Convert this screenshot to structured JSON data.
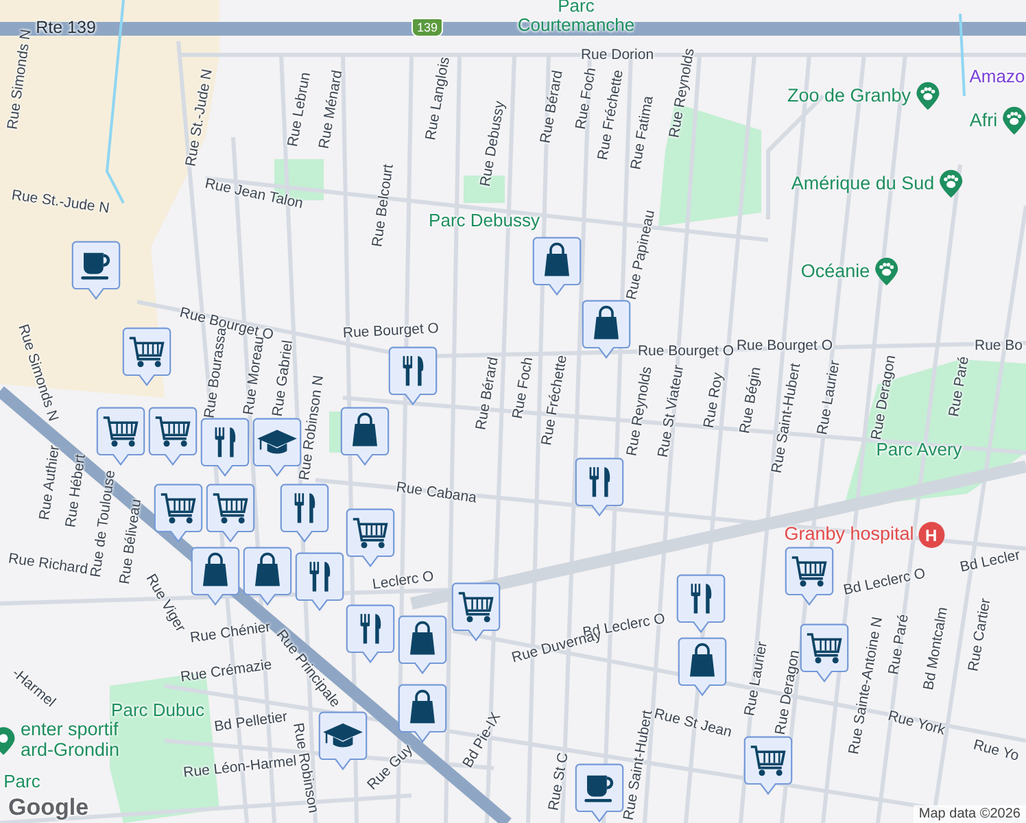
{
  "map": {
    "route_shield": "139",
    "labels": [
      {
        "text": "Rte 139",
        "kind": "highway"
      },
      {
        "text": "Parc Courtemanche",
        "kind": "park"
      },
      {
        "text": "Rue Dorion",
        "kind": "street"
      },
      {
        "text": "Rue Simonds N",
        "kind": "street"
      },
      {
        "text": "Rue St.-Jude N",
        "kind": "street"
      },
      {
        "text": "Rue Lebrun",
        "kind": "street"
      },
      {
        "text": "Rue Ménard",
        "kind": "street"
      },
      {
        "text": "Rue Langlois",
        "kind": "street"
      },
      {
        "text": "Rue Debussy",
        "kind": "street"
      },
      {
        "text": "Rue Bérard",
        "kind": "street"
      },
      {
        "text": "Rue Foch",
        "kind": "street"
      },
      {
        "text": "Rue Fréchette",
        "kind": "street"
      },
      {
        "text": "Rue Fatima",
        "kind": "street"
      },
      {
        "text": "Rue Reynolds",
        "kind": "street"
      },
      {
        "text": "Amazo",
        "kind": "attraction"
      },
      {
        "text": "Rue Jean Talon",
        "kind": "street"
      },
      {
        "text": "Rue St.-Jude N",
        "kind": "street"
      },
      {
        "text": "Rue Belcourt",
        "kind": "street"
      },
      {
        "text": "Parc Debussy",
        "kind": "park"
      },
      {
        "text": "Rue Papineau",
        "kind": "street"
      },
      {
        "text": "Rue Simonds N",
        "kind": "street"
      },
      {
        "text": "Rue Bourget O",
        "kind": "street"
      },
      {
        "text": "Rue Bourget O",
        "kind": "street"
      },
      {
        "text": "Rue Bourget O",
        "kind": "street"
      },
      {
        "text": "Rue Bourget O",
        "kind": "street"
      },
      {
        "text": "Rue Bo",
        "kind": "street"
      },
      {
        "text": "Rue Bourassa",
        "kind": "street"
      },
      {
        "text": "Rue Moreau",
        "kind": "street"
      },
      {
        "text": "Rue Gabriel",
        "kind": "street"
      },
      {
        "text": "Rue Bérard",
        "kind": "street"
      },
      {
        "text": "Rue Foch",
        "kind": "street"
      },
      {
        "text": "Rue Fréchette",
        "kind": "street"
      },
      {
        "text": "Rue Reynolds",
        "kind": "street"
      },
      {
        "text": "Rue St Viateur",
        "kind": "street"
      },
      {
        "text": "Rue Roy",
        "kind": "street"
      },
      {
        "text": "Rue Bégin",
        "kind": "street"
      },
      {
        "text": "Rue Saint-Hubert",
        "kind": "street"
      },
      {
        "text": "Rue Laurier",
        "kind": "street"
      },
      {
        "text": "Rue Deragon",
        "kind": "street"
      },
      {
        "text": "Rue Paré",
        "kind": "street"
      },
      {
        "text": "Parc Avery",
        "kind": "park"
      },
      {
        "text": "Rue Robinson N",
        "kind": "street"
      },
      {
        "text": "Rue Cabana",
        "kind": "street"
      },
      {
        "text": "Rue Authier",
        "kind": "street"
      },
      {
        "text": "Rue Hébert",
        "kind": "street"
      },
      {
        "text": "Rue de Toulouse",
        "kind": "street"
      },
      {
        "text": "Rue Béliveau",
        "kind": "street"
      },
      {
        "text": "Rue Richard",
        "kind": "street"
      },
      {
        "text": "Rue Viger",
        "kind": "street"
      },
      {
        "text": "Leclerc O",
        "kind": "street"
      },
      {
        "text": "Bd Leclerc O",
        "kind": "street"
      },
      {
        "text": "Bd Leclerc O",
        "kind": "street"
      },
      {
        "text": "Bd Lecler",
        "kind": "street"
      },
      {
        "text": "Rue Chénier",
        "kind": "street"
      },
      {
        "text": "Rue Crémazie",
        "kind": "street"
      },
      {
        "text": "Rue Principale",
        "kind": "street"
      },
      {
        "text": "Rue Duvernay",
        "kind": "street"
      },
      {
        "text": "Rue Laurier",
        "kind": "street"
      },
      {
        "text": "Rue Deragon",
        "kind": "street"
      },
      {
        "text": "Rue Sainte-Antoine N",
        "kind": "street"
      },
      {
        "text": "Rue Paré",
        "kind": "street"
      },
      {
        "text": "Bd Montcalm",
        "kind": "street"
      },
      {
        "text": "Rue Cartier",
        "kind": "street"
      },
      {
        "text": "Rue York",
        "kind": "street"
      },
      {
        "text": "Rue Yo",
        "kind": "street"
      },
      {
        "text": "Rue St Jean",
        "kind": "street"
      },
      {
        "text": "Parc Dubuc",
        "kind": "park"
      },
      {
        "text": "Bd Pelletier",
        "kind": "street"
      },
      {
        "text": "Rue Léon-Harmel",
        "kind": "street"
      },
      {
        "text": "Rue Robinson",
        "kind": "street"
      },
      {
        "text": "Rue Guy",
        "kind": "street"
      },
      {
        "text": "Bd Pie-IX",
        "kind": "street"
      },
      {
        "text": "Rue Saint-Hubert",
        "kind": "street"
      },
      {
        "text": "Rue St C",
        "kind": "street"
      },
      {
        "text": "-Harmel",
        "kind": "street"
      },
      {
        "text": "Parc",
        "kind": "park"
      }
    ],
    "places": [
      {
        "name": "Zoo de Granby",
        "kind": "zoo"
      },
      {
        "name": "Afri",
        "kind": "zoo"
      },
      {
        "name": "Amérique du Sud",
        "kind": "zoo"
      },
      {
        "name": "Océanie",
        "kind": "zoo"
      },
      {
        "name": "Granby hospital",
        "kind": "hospital",
        "badge": "H"
      },
      {
        "name": "enter sportif\nard-Grondin",
        "kind": "sport"
      }
    ],
    "markers": [
      {
        "kind": "cafe"
      },
      {
        "kind": "grocery"
      },
      {
        "kind": "restaurant"
      },
      {
        "kind": "school"
      },
      {
        "kind": "shopping"
      },
      {
        "kind": "restaurant"
      },
      {
        "kind": "shopping"
      },
      {
        "kind": "shopping"
      },
      {
        "kind": "grocery"
      },
      {
        "kind": "grocery"
      },
      {
        "kind": "grocery"
      },
      {
        "kind": "grocery"
      },
      {
        "kind": "shopping"
      },
      {
        "kind": "restaurant"
      },
      {
        "kind": "grocery"
      },
      {
        "kind": "shopping"
      },
      {
        "kind": "restaurant"
      },
      {
        "kind": "restaurant"
      },
      {
        "kind": "grocery"
      },
      {
        "kind": "shopping"
      },
      {
        "kind": "shopping"
      },
      {
        "kind": "restaurant"
      },
      {
        "kind": "restaurant"
      },
      {
        "kind": "shopping"
      },
      {
        "kind": "grocery"
      },
      {
        "kind": "grocery"
      },
      {
        "kind": "grocery"
      },
      {
        "kind": "school"
      },
      {
        "kind": "cafe"
      }
    ],
    "logo": "Google",
    "attribution": "Map data ©2026"
  }
}
